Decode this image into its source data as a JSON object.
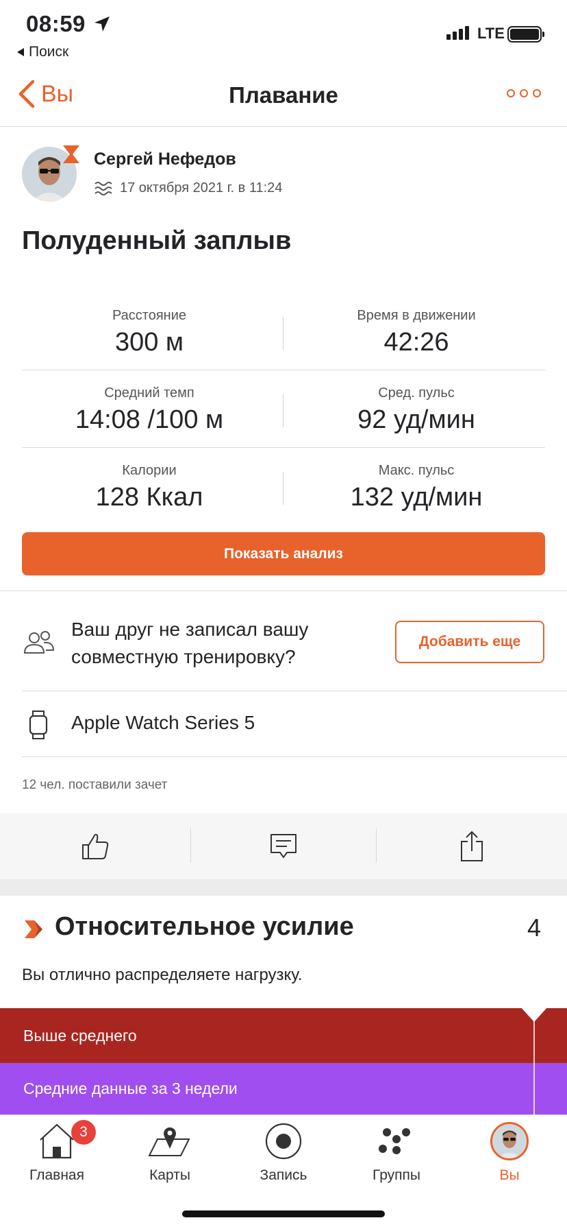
{
  "status_bar": {
    "time": "08:59",
    "back_app": "Поиск",
    "network": "LTE"
  },
  "nav": {
    "back_label": "Вы",
    "title": "Плавание",
    "more_icon": "more-horizontal-icon"
  },
  "activity": {
    "athlete": "Сергей Нефедов",
    "datetime": "17 октября 2021 г. в 11:24",
    "sport_icon": "swim-icon",
    "title": "Полуденный заплыв"
  },
  "stats": [
    {
      "label": "Расстояние",
      "value": "300 м"
    },
    {
      "label": "Время в движении",
      "value": "42:26"
    },
    {
      "label": "Средний темп",
      "value": "14:08 /100 м"
    },
    {
      "label": "Сред. пульс",
      "value": "92 уд/мин"
    },
    {
      "label": "Калории",
      "value": "128 Ккал"
    },
    {
      "label": "Макс. пульс",
      "value": "132 уд/мин"
    }
  ],
  "analysis_button": "Показать анализ",
  "friend_prompt": {
    "line1": "Ваш друг не записал вашу",
    "line2": "совместную тренировку?",
    "button": "Добавить еще"
  },
  "device": "Apple Watch Series 5",
  "kudos_text": "12 чел. поставили зачет",
  "actions": [
    "thumbs-up-icon",
    "comment-icon",
    "share-icon"
  ],
  "relative_effort": {
    "title": "Относительное усилие",
    "score": "4",
    "description": "Вы отлично распределяете нагрузку.",
    "band_above": "Выше среднего",
    "band_average": "Средние данные за 3 недели"
  },
  "tabs": [
    {
      "label": "Главная",
      "icon": "home-icon",
      "badge": "3"
    },
    {
      "label": "Карты",
      "icon": "map-icon"
    },
    {
      "label": "Запись",
      "icon": "record-icon"
    },
    {
      "label": "Группы",
      "icon": "groups-icon"
    },
    {
      "label": "Вы",
      "icon": "profile-avatar",
      "active": true
    }
  ],
  "colors": {
    "accent": "#e8622c",
    "band_red": "#a92620",
    "band_purple": "#a04ef0"
  }
}
